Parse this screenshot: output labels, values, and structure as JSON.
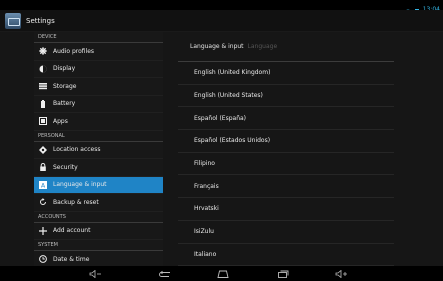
{
  "status_bar": {
    "time": "13:04"
  },
  "action_bar": {
    "title": "Settings"
  },
  "sidebar": {
    "sections": {
      "device": "DEVICE",
      "personal": "PERSONAL",
      "accounts": "ACCOUNTS",
      "system": "SYSTEM"
    },
    "items": [
      {
        "label": "Audio profiles",
        "icon": "equalizer-icon"
      },
      {
        "label": "Display",
        "icon": "brightness-icon"
      },
      {
        "label": "Storage",
        "icon": "storage-icon"
      },
      {
        "label": "Battery",
        "icon": "battery-icon"
      },
      {
        "label": "Apps",
        "icon": "apps-icon"
      },
      {
        "label": "Location access",
        "icon": "location-icon"
      },
      {
        "label": "Security",
        "icon": "lock-icon"
      },
      {
        "label": "Language & input",
        "icon": "language-icon"
      },
      {
        "label": "Backup & reset",
        "icon": "backup-icon"
      },
      {
        "label": "Add account",
        "icon": "plus-icon"
      },
      {
        "label": "Date & time",
        "icon": "clock-icon"
      }
    ]
  },
  "detail": {
    "breadcrumb": "Language & input",
    "breadcrumb_sub": "Language",
    "languages": [
      "English (United Kingdom)",
      "English (United States)",
      "Español (España)",
      "Español (Estados Unidos)",
      "Filipino",
      "Français",
      "Hrvatski",
      "IsiZulu",
      "Italiano"
    ]
  },
  "colors": {
    "accent": "#1f84c6",
    "background": "#161616"
  }
}
